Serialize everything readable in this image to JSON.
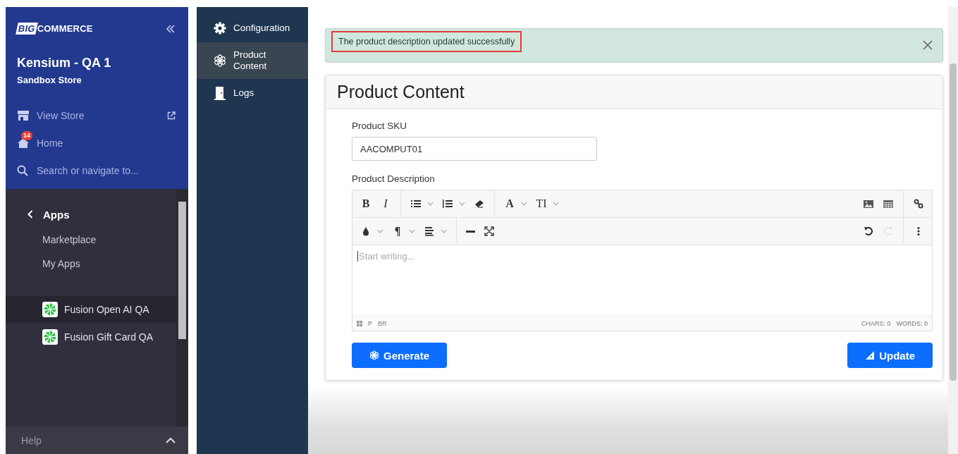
{
  "store_nav": {
    "logo_mark": "BIG",
    "logo_text": "COMMERCE",
    "store_name": "Kensium - QA 1",
    "store_type": "Sandbox Store",
    "links": [
      {
        "kind": "store",
        "label": "View Store",
        "external": true
      },
      {
        "kind": "home",
        "label": "Home",
        "badge": "14",
        "external": false
      },
      {
        "kind": "search",
        "label": "Search or navigate to...",
        "external": false
      }
    ]
  },
  "apps_nav": {
    "back_label": "Apps",
    "items": [
      {
        "label": "Marketplace"
      },
      {
        "label": "My Apps"
      }
    ],
    "apps": [
      {
        "label": "Fusion Open AI QA",
        "selected": true
      },
      {
        "label": "Fusion Gift Card QA",
        "selected": false
      }
    ],
    "help": "Help"
  },
  "app_menu": [
    {
      "kind": "gear",
      "label": "Configuration",
      "selected": false
    },
    {
      "kind": "flower",
      "label": "Product Content",
      "selected": true
    },
    {
      "kind": "door",
      "label": "Logs",
      "selected": false
    }
  ],
  "alert": {
    "message": "The product description updated successfully",
    "highlighted": true
  },
  "panel": {
    "title": "Product Content",
    "sku_label": "Product SKU",
    "sku_value": "AACOMPUT01",
    "description_label": "Product Description",
    "editor": {
      "placeholder": "Start writing...",
      "toolbar_rows": [
        [
          {
            "kind": "bold",
            "text": "B",
            "dropdown": false,
            "disabled": false
          },
          {
            "kind": "italic",
            "text": "I",
            "dropdown": false,
            "disabled": false
          },
          {
            "kind": "separator"
          },
          {
            "kind": "bullets",
            "dropdown": true,
            "disabled": false
          },
          {
            "kind": "numbered",
            "dropdown": true,
            "disabled": false
          },
          {
            "kind": "eraser",
            "dropdown": false,
            "disabled": false
          },
          {
            "kind": "separator"
          },
          {
            "kind": "bold",
            "text": "A",
            "dropdown": true,
            "disabled": false
          },
          {
            "kind": "plain",
            "text": "TI",
            "dropdown": true,
            "disabled": false
          },
          {
            "kind": "spacer"
          },
          {
            "kind": "image",
            "dropdown": false,
            "disabled": false
          },
          {
            "kind": "table",
            "dropdown": false,
            "disabled": false
          },
          {
            "kind": "separator"
          },
          {
            "kind": "link",
            "dropdown": false,
            "disabled": false
          }
        ],
        [
          {
            "kind": "drop",
            "dropdown": true,
            "disabled": false
          },
          {
            "kind": "bold",
            "text": "¶",
            "dropdown": true,
            "disabled": false
          },
          {
            "kind": "align",
            "dropdown": true,
            "disabled": false
          },
          {
            "kind": "separator"
          },
          {
            "kind": "rule",
            "dropdown": false,
            "disabled": false
          },
          {
            "kind": "fullscreen",
            "dropdown": false,
            "disabled": false
          },
          {
            "kind": "spacer"
          },
          {
            "kind": "undo",
            "dropdown": false,
            "disabled": false
          },
          {
            "kind": "redo",
            "dropdown": false,
            "disabled": true
          },
          {
            "kind": "separator"
          },
          {
            "kind": "more",
            "dropdown": false,
            "disabled": false
          }
        ]
      ],
      "path": [
        "P",
        "BR"
      ],
      "chars": "CHARS: 0",
      "words": "WORDS: 0"
    },
    "buttons": [
      {
        "kind": "generate",
        "label": "Generate"
      },
      {
        "kind": "update",
        "label": "Update"
      }
    ]
  }
}
